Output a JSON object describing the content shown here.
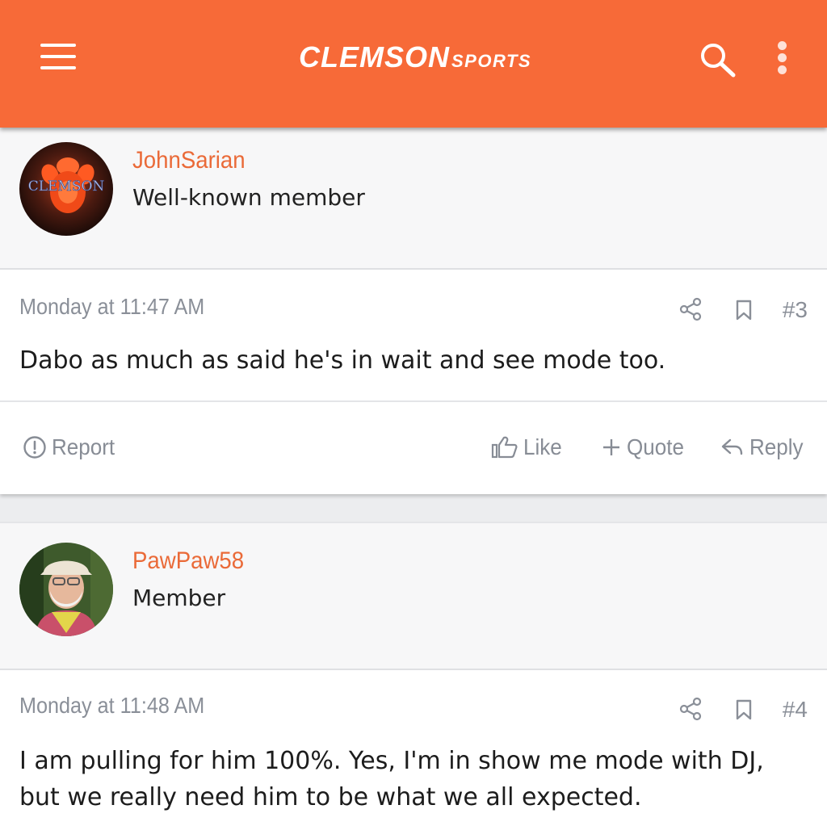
{
  "header": {
    "logo_main": "CLEMSON",
    "logo_sub": "SPORTS",
    "bg_color": "#f76a38"
  },
  "posts": [
    {
      "username": "JohnSarian",
      "user_title": "Well-known member",
      "date": "Monday at 11:47 AM",
      "post_number": "#3",
      "message": "Dabo as much as said he's in wait and see mode too."
    },
    {
      "username": "PawPaw58",
      "user_title": "Member",
      "date": "Monday at 11:48 AM",
      "post_number": "#4",
      "message": "I am pulling for him 100%. Yes, I'm in show me mode with DJ, but we really need him to be what we all expected."
    }
  ],
  "actions": {
    "report": "Report",
    "like": "Like",
    "quote": "Quote",
    "reply": "Reply"
  },
  "colors": {
    "accent": "#f76a38",
    "username": "#ea6a38",
    "muted": "#8a8f98"
  }
}
